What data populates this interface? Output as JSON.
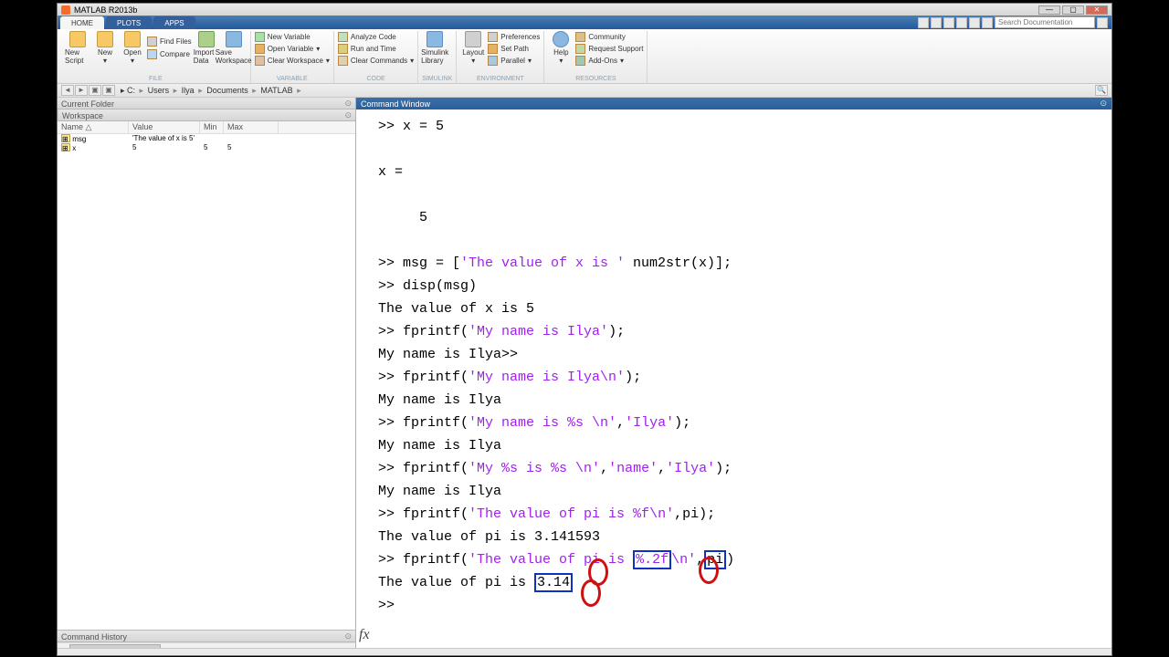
{
  "window": {
    "title": "MATLAB R2013b"
  },
  "tabs": {
    "home": "HOME",
    "plots": "PLOTS",
    "apps": "APPS"
  },
  "search": {
    "placeholder": "Search Documentation"
  },
  "toolstrip": {
    "file": {
      "label": "FILE",
      "new_script": "New\nScript",
      "new": "New",
      "open": "Open",
      "find_files": "Find Files",
      "compare": "Compare",
      "import": "Import\nData",
      "save_ws": "Save\nWorkspace"
    },
    "variable": {
      "label": "VARIABLE",
      "new_var": "New Variable",
      "open_var": "Open Variable",
      "clear_ws": "Clear Workspace"
    },
    "code": {
      "label": "CODE",
      "analyze": "Analyze Code",
      "run_time": "Run and Time",
      "clear_cmd": "Clear Commands"
    },
    "simulink": {
      "label": "SIMULINK",
      "lib": "Simulink\nLibrary"
    },
    "environment": {
      "label": "ENVIRONMENT",
      "layout": "Layout",
      "prefs": "Preferences",
      "set_path": "Set Path",
      "parallel": "Parallel"
    },
    "resources": {
      "label": "RESOURCES",
      "help": "Help",
      "community": "Community",
      "support": "Request Support",
      "addons": "Add-Ons"
    }
  },
  "path": {
    "parts": [
      "C:",
      "Users",
      "Ilya",
      "Documents",
      "MATLAB"
    ]
  },
  "panels": {
    "current_folder": "Current Folder",
    "workspace": "Workspace",
    "command_history": "Command History",
    "command_window": "Command Window"
  },
  "workspace": {
    "cols": {
      "name": "Name △",
      "value": "Value",
      "min": "Min",
      "max": "Max"
    },
    "rows": [
      {
        "name": "msg",
        "value": "'The value of x is 5'",
        "min": "",
        "max": ""
      },
      {
        "name": "x",
        "value": "5",
        "min": "5",
        "max": "5"
      }
    ]
  },
  "cmd": {
    "l1": ">> x = 5",
    "l2": "x =",
    "l3": "     5",
    "l4a": ">> msg = [",
    "l4s": "'The value of x is '",
    "l4b": " num2str(x)];",
    "l5": ">> disp(msg)",
    "l6": "The value of x is 5",
    "l7a": ">> fprintf(",
    "l7s": "'My name is Ilya'",
    "l7b": ");",
    "l8": "My name is Ilya>>",
    "l9a": ">> fprintf(",
    "l9s": "'My name is Ilya\\n'",
    "l9b": ");",
    "l10": "My name is Ilya",
    "l11a": ">> fprintf(",
    "l11s": "'My name is %s \\n'",
    "l11c": ",",
    "l11s2": "'Ilya'",
    "l11b": ");",
    "l12": "My name is Ilya",
    "l13a": ">> fprintf(",
    "l13s": "'My %s is %s \\n'",
    "l13c1": ",",
    "l13s2": "'name'",
    "l13c2": ",",
    "l13s3": "'Ilya'",
    "l13b": ");",
    "l14": "My name is Ilya",
    "l15a": ">> fprintf(",
    "l15s": "'The value of pi is %f\\n'",
    "l15c": ",pi);",
    "l16": "The value of pi is 3.141593",
    "l17a": ">> fprintf(",
    "l17s1": "'The value of pi is ",
    "l17box1": "%.2f",
    "l17s2": "\\n'",
    "l17c": ",",
    "l17box2": "pi",
    "l17b": ")",
    "l18a": "The value of pi is ",
    "l18box": "3.14",
    "l19": ">> "
  }
}
